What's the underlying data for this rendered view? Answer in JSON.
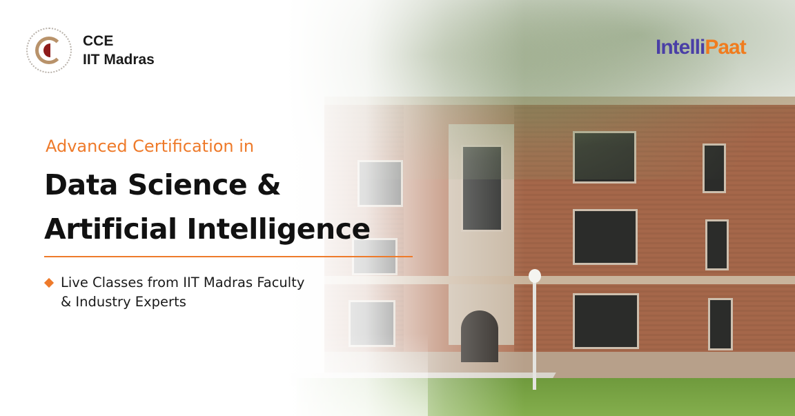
{
  "brand_left": {
    "line1": "CCE",
    "line2": "IIT Madras"
  },
  "brand_right": {
    "part1": "Intelli",
    "part2": "Paat"
  },
  "headline": {
    "pre": "Advanced Certification in",
    "line1": "Data Science &",
    "line2": "Artificial Intelligence"
  },
  "bullets": [
    {
      "line1": "Live Classes from IIT Madras Faculty",
      "line2": "& Industry Experts"
    }
  ],
  "colors": {
    "accent": "#ee7a2a",
    "brand_purple": "#4a3fa6"
  }
}
